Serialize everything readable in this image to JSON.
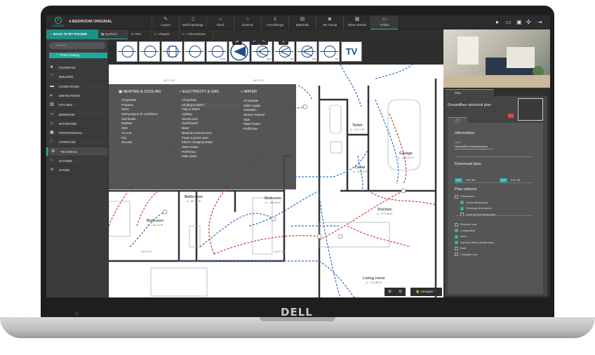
{
  "app": {
    "logo": "CEDREO",
    "title": "4-BEDROOM ORIGINAL"
  },
  "menu": [
    {
      "label": "Layout",
      "icon": "pencil-icon"
    },
    {
      "label": "Wall Openings",
      "icon": "door-icon"
    },
    {
      "label": "Roof",
      "icon": "roof-icon"
    },
    {
      "label": "Exterior",
      "icon": "house-icon"
    },
    {
      "label": "Furnishings",
      "icon": "chair-icon"
    },
    {
      "label": "Materials",
      "icon": "paint-roller-icon"
    },
    {
      "label": "HD Visual",
      "icon": "camera-icon"
    },
    {
      "label": "Plans details",
      "icon": "plans-icon"
    },
    {
      "label": "Folder",
      "icon": "folder-icon"
    }
  ],
  "subbar": {
    "back": "BACK TO MY FOLDER",
    "tabs": [
      "Symbols",
      "Text",
      "Shapes",
      "Dimensions"
    ]
  },
  "sidebar": {
    "search_placeholder": "search...",
    "close_catalog": "Close Catalog",
    "items": [
      "FAVORITES",
      "BUILDING",
      "LIVING ROOM",
      "DINING ROOM",
      "KITCHEN",
      "BEDROOM",
      "BATHROOM",
      "PROFESSIONAL",
      "STAIRCASE",
      "TECHNICAL",
      "OUTSIDE",
      "OTHER"
    ],
    "active": "TECHNICAL"
  },
  "symbols": [
    "",
    "",
    "",
    "",
    "GPCV",
    "",
    "REF",
    "CW",
    "DW",
    "CD",
    "TV"
  ],
  "catalog": {
    "heating": {
      "title": "HEATING & COOLING",
      "items": [
        "All symbols",
        "Fireplace",
        "Stove",
        "Heat pump & Air conditioner",
        "Gas heater",
        "Radiator",
        "CMV",
        "Air vent",
        "Fan",
        "Security"
      ]
    },
    "electricity": {
      "title": "ELECTRICITY & GAS",
      "items": [
        "All symbols",
        "US plug & switch",
        "Plug & Switch",
        "Lighting",
        "Service duct",
        "Switchboard",
        "Meter",
        "Manhole & Electric box",
        "Power & phone pole",
        "Electric charging station",
        "Water heater",
        "ProfTil Box",
        "Solar panel"
      ],
      "highlighted": "US plug & switch"
    },
    "water": {
      "title": "WATER",
      "items": [
        "All symbols",
        "Water supply",
        "Sanitation",
        "Shower channel",
        "Taps",
        "Water heater",
        "ProfTil Box"
      ]
    }
  },
  "plan": {
    "mot": "MOT RS",
    "rooms": [
      {
        "name": "Toilet",
        "area": "A : 34.27 ft²"
      },
      {
        "name": "Garage",
        "area": "A : 158.00 ft²"
      },
      {
        "name": "Cellar",
        "area": "A : 31.83 ft²"
      },
      {
        "name": "Bathroom",
        "area": "A : 89.16 ft²"
      },
      {
        "name": "Bedroom",
        "area": "A : 168.68 ft²"
      },
      {
        "name": "Kitchen",
        "area": "A : 179.56 ft²"
      },
      {
        "name": "Bedroom",
        "area": "A : 146.10 ft²"
      },
      {
        "name": "Living room",
        "area": "A : 279.88 ft²"
      }
    ],
    "navigate": "Navigate"
  },
  "panel": {
    "tab": "Plan",
    "plan_name": "Groundfloor electrical plan",
    "info_title": "Information",
    "name_label": "Name",
    "name_value": "Groundfloor electrical plan",
    "download_title": "Download plan",
    "jpg": "JPG",
    "jpg_label": "JPG file",
    "dxf": "DXF",
    "dxf_label": "DXF file",
    "options_title": "Plan options",
    "options": [
      {
        "label": "Dimensions",
        "checked": false,
        "indent": false
      },
      {
        "label": "House dimensions",
        "checked": true,
        "indent": true
      },
      {
        "label": "Openings dimensions",
        "checked": true,
        "indent": true
      },
      {
        "label": "Level terrace dimensions",
        "checked": false,
        "indent": true
      },
      {
        "label": "Structure only",
        "checked": false,
        "indent": false
      },
      {
        "label": "Composition",
        "checked": true,
        "indent": false
      },
      {
        "label": "Area",
        "checked": true,
        "indent": false
      },
      {
        "label": "Symbols (Plans details step)",
        "checked": true,
        "indent": false
      },
      {
        "label": "Roof",
        "checked": false,
        "indent": false
      },
      {
        "label": "Compass rose",
        "checked": false,
        "indent": false
      }
    ]
  },
  "brand": "DELL",
  "colors": {
    "accent": "#22a99d",
    "blue_line": "#2e6fc4",
    "red_line": "#d23a3a"
  }
}
